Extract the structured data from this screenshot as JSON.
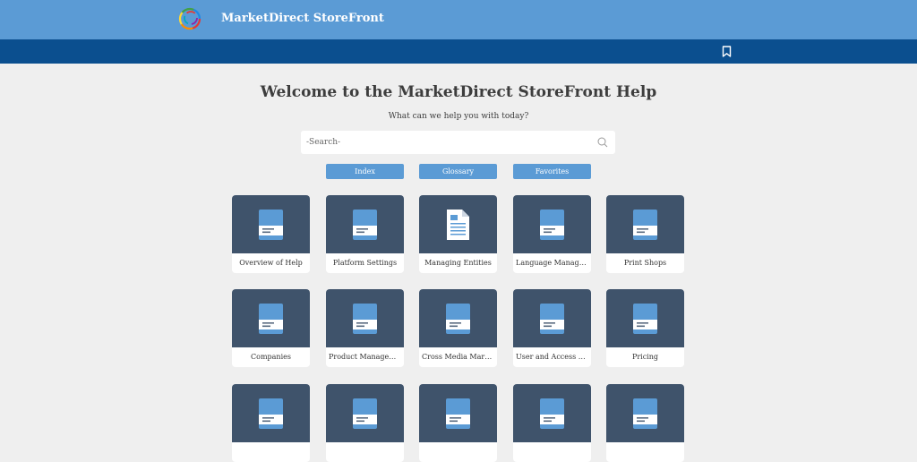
{
  "header": {
    "brand": "MarketDirect StoreFront"
  },
  "nav": {
    "bookmark_icon": "bookmark-icon"
  },
  "main": {
    "title": "Welcome to the MarketDirect StoreFront Help",
    "subtitle": "What can we help you with today?",
    "search": {
      "placeholder": "-Search-",
      "value": ""
    },
    "buttons": [
      {
        "label": "Index"
      },
      {
        "label": "Glossary"
      },
      {
        "label": "Favorites"
      }
    ],
    "cards": [
      {
        "label": "Overview of Help",
        "icon": "book-icon"
      },
      {
        "label": "Platform Settings",
        "icon": "book-icon"
      },
      {
        "label": "Managing Entities",
        "icon": "document-icon"
      },
      {
        "label": "Language Management",
        "icon": "book-icon"
      },
      {
        "label": "Print Shops",
        "icon": "book-icon"
      },
      {
        "label": "Companies",
        "icon": "book-icon"
      },
      {
        "label": "Product Management",
        "icon": "book-icon"
      },
      {
        "label": "Cross Media Marketing",
        "icon": "book-icon"
      },
      {
        "label": "User and Access Management",
        "icon": "book-icon"
      },
      {
        "label": "Pricing",
        "icon": "book-icon"
      },
      {
        "label": "",
        "icon": "book-icon"
      },
      {
        "label": "",
        "icon": "book-icon"
      },
      {
        "label": "",
        "icon": "book-icon"
      },
      {
        "label": "",
        "icon": "book-icon"
      },
      {
        "label": "",
        "icon": "book-icon"
      }
    ]
  },
  "colors": {
    "header_bg": "#5b9bd5",
    "nav_bg": "#0b4f8f",
    "card_bg": "#3f536b",
    "accent": "#5b9bd5"
  }
}
